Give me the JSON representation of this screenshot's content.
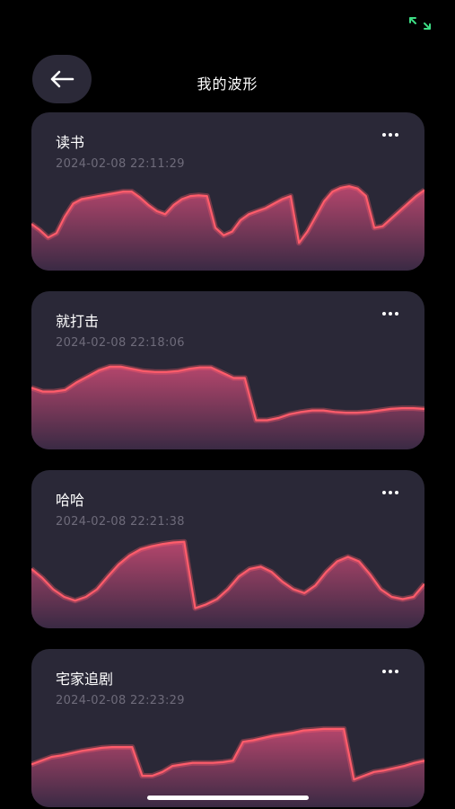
{
  "header": {
    "title": "我的波形"
  },
  "colors": {
    "background": "#000000",
    "card": "#2a2837",
    "back_button": "#2b2938",
    "wave_line": "#ff5c6b",
    "wave_fill_top": "#b4466c",
    "wave_fill_bottom": "#3a2a44",
    "timestamp": "#6e6b7a",
    "status_indicator": "#3ddc84"
  },
  "icons": {
    "back": "arrow-left-icon",
    "more": "more-horizontal-icon",
    "status": "expand-arrows-icon"
  },
  "waveforms": [
    {
      "title": "读书",
      "time": "2024-02-08 22:11:29",
      "levels": [
        0.45,
        0.37,
        0.27,
        0.33,
        0.55,
        0.72,
        0.78,
        0.8,
        0.82,
        0.84,
        0.86,
        0.88,
        0.88,
        0.8,
        0.7,
        0.62,
        0.58,
        0.7,
        0.78,
        0.82,
        0.83,
        0.82,
        0.4,
        0.3,
        0.35,
        0.5,
        0.58,
        0.62,
        0.66,
        0.72,
        0.78,
        0.82,
        0.2,
        0.35,
        0.55,
        0.75,
        0.88,
        0.93,
        0.95,
        0.92,
        0.82,
        0.4,
        0.42,
        0.52,
        0.62,
        0.72,
        0.82,
        0.9
      ]
    },
    {
      "title": "就打击",
      "time": "2024-02-08 22:18:06",
      "levels": [
        0.65,
        0.6,
        0.6,
        0.62,
        0.72,
        0.8,
        0.88,
        0.93,
        0.93,
        0.9,
        0.87,
        0.86,
        0.86,
        0.87,
        0.9,
        0.92,
        0.92,
        0.85,
        0.78,
        0.78,
        0.22,
        0.22,
        0.25,
        0.3,
        0.33,
        0.35,
        0.35,
        0.33,
        0.32,
        0.32,
        0.33,
        0.35,
        0.37,
        0.38,
        0.38,
        0.37
      ]
    },
    {
      "title": "哈哈",
      "time": "2024-02-08 22:21:38",
      "levels": [
        0.62,
        0.5,
        0.35,
        0.25,
        0.2,
        0.25,
        0.35,
        0.52,
        0.68,
        0.8,
        0.88,
        0.92,
        0.95,
        0.97,
        0.98,
        0.1,
        0.15,
        0.22,
        0.35,
        0.52,
        0.62,
        0.65,
        0.58,
        0.45,
        0.35,
        0.3,
        0.4,
        0.58,
        0.72,
        0.78,
        0.72,
        0.55,
        0.35,
        0.25,
        0.22,
        0.25,
        0.42
      ]
    },
    {
      "title": "宅家追剧",
      "time": "2024-02-08 22:23:29",
      "levels": [
        0.4,
        0.45,
        0.5,
        0.52,
        0.55,
        0.58,
        0.6,
        0.62,
        0.63,
        0.63,
        0.63,
        0.25,
        0.25,
        0.3,
        0.38,
        0.4,
        0.42,
        0.42,
        0.42,
        0.43,
        0.45,
        0.7,
        0.72,
        0.75,
        0.78,
        0.8,
        0.82,
        0.85,
        0.86,
        0.87,
        0.87,
        0.87,
        0.2,
        0.25,
        0.3,
        0.32,
        0.35,
        0.38,
        0.42,
        0.45
      ]
    }
  ]
}
